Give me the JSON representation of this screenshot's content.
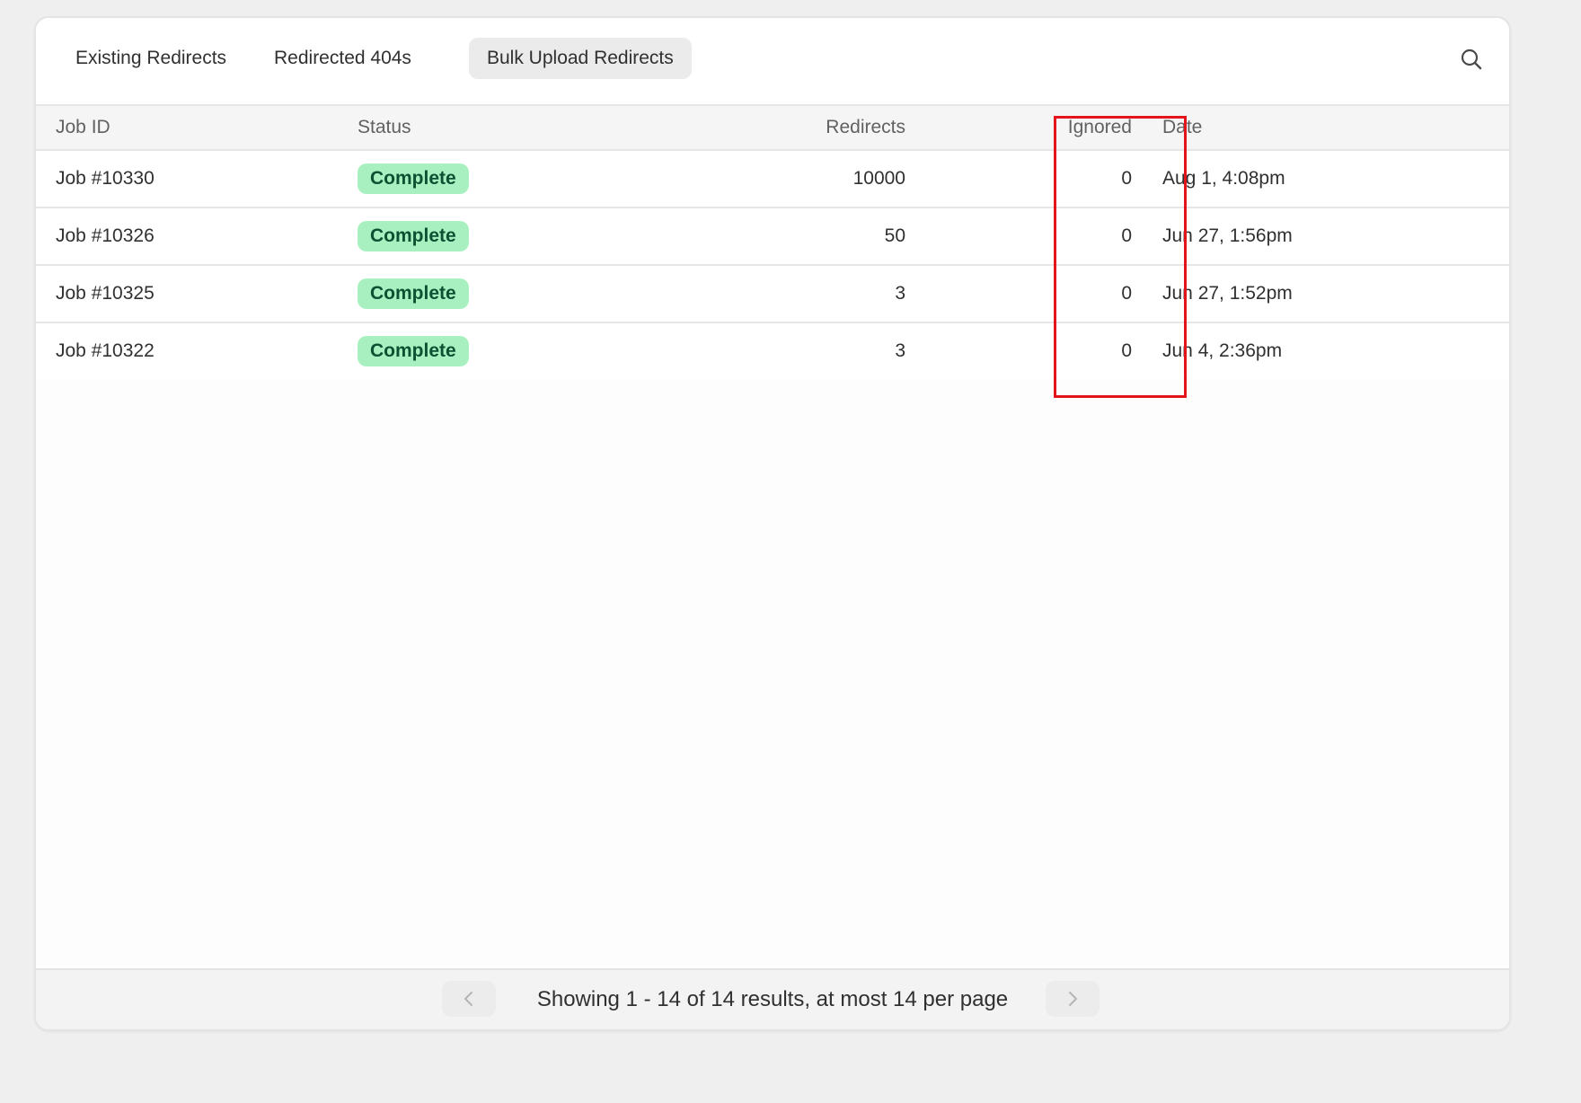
{
  "tabs": [
    {
      "label": "Existing Redirects",
      "active": false
    },
    {
      "label": "Redirected 404s",
      "active": false
    },
    {
      "label": "Bulk Upload Redirects",
      "active": true
    }
  ],
  "search": {
    "icon": "search-icon"
  },
  "table": {
    "headers": {
      "job_id": "Job ID",
      "status": "Status",
      "redirects": "Redirects",
      "ignored": "Ignored",
      "date": "Date"
    },
    "rows": [
      {
        "job_id": "Job #10330",
        "status": "Complete",
        "redirects": "10000",
        "ignored": "0",
        "date": "Aug 1, 4:08pm"
      },
      {
        "job_id": "Job #10326",
        "status": "Complete",
        "redirects": "50",
        "ignored": "0",
        "date": "Jun 27, 1:56pm"
      },
      {
        "job_id": "Job #10325",
        "status": "Complete",
        "redirects": "3",
        "ignored": "0",
        "date": "Jun 27, 1:52pm"
      },
      {
        "job_id": "Job #10322",
        "status": "Complete",
        "redirects": "3",
        "ignored": "0",
        "date": "Jun 4, 2:36pm"
      }
    ]
  },
  "pagination": {
    "summary": "Showing 1 - 14 of 14 results, at most 14 per page",
    "prev_icon": "chevron-left-icon",
    "next_icon": "chevron-right-icon"
  },
  "colors": {
    "status_complete_bg": "#a8f0c0",
    "status_complete_text": "#0c5132",
    "highlight_border": "#e3151a"
  }
}
